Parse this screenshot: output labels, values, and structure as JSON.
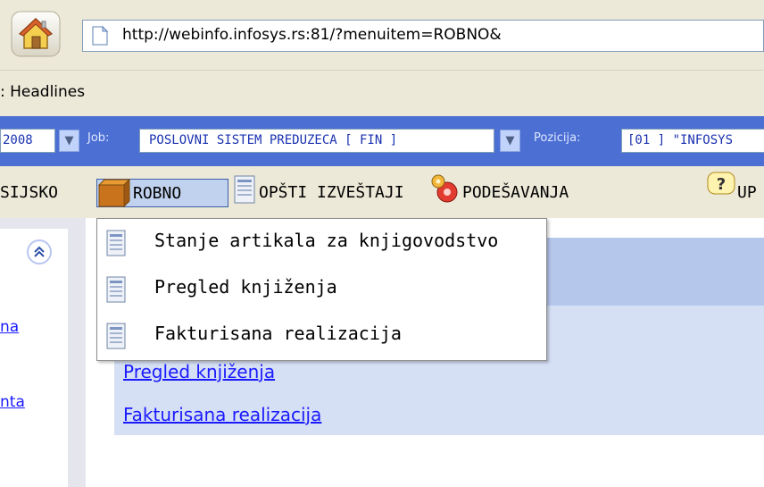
{
  "browser": {
    "url": "http://webinfo.infosys.rs:81/?menuitem=ROBNO&",
    "links_bar_text": ": Headlines"
  },
  "app_bar": {
    "date_value": "2008",
    "job_label": "Job:",
    "job_value": "POSLOVNI SISTEM PREDUZECA [ FIN ]",
    "pozicija_label": "Pozicija:",
    "pozicija_value": "[01 ] \"INFOSYS"
  },
  "menu": {
    "items": [
      {
        "label": "SIJSKO"
      },
      {
        "label": "ROBNO"
      },
      {
        "label": "OPŠTI IZVEŠTAJI"
      },
      {
        "label": "PODEŠAVANJA"
      },
      {
        "label": "UP"
      }
    ]
  },
  "dropdown": {
    "items": [
      {
        "label": "Stanje artikala za knjigovodstvo"
      },
      {
        "label": "Pregled knjiženja"
      },
      {
        "label": "Fakturisana realizacija"
      }
    ]
  },
  "left_panel": {
    "links": [
      {
        "label": "na"
      },
      {
        "label": "nta"
      }
    ]
  },
  "content": {
    "links": [
      {
        "label": "Pregled knjiženja"
      },
      {
        "label": "Fakturisana realizacija"
      }
    ]
  },
  "colors": {
    "app_bar": "#4c6fd3",
    "link": "#1a1aff",
    "content_header": "#b6c7ec",
    "content_body": "#d6e0f5"
  }
}
